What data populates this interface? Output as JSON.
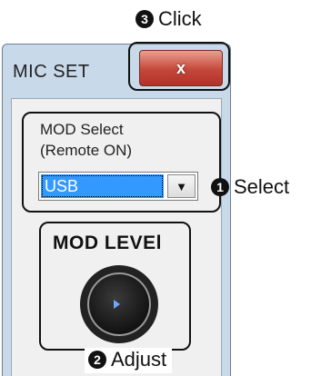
{
  "callouts": {
    "click": {
      "num": "❸",
      "text": "Click"
    },
    "select": {
      "num": "❶",
      "text": "Select"
    },
    "adjust": {
      "num": "❷",
      "text": "Adjust"
    }
  },
  "window": {
    "title": "MIC SET",
    "close_glyph": "x"
  },
  "mod_select": {
    "label_line1": "MOD Select",
    "label_line2": "(Remote ON)",
    "selected_value": "USB",
    "dropdown_glyph": "▼"
  },
  "mod_level": {
    "label": "MOD LEVEl"
  },
  "icons": {
    "close": "close-icon",
    "dropdown": "chevron-down-icon",
    "knob": "knob-icon"
  },
  "colors": {
    "window_frame": "#c8d9ea",
    "close_button": "#c6473a",
    "selection": "#3399ff",
    "knob_marker": "#6da8ff"
  }
}
